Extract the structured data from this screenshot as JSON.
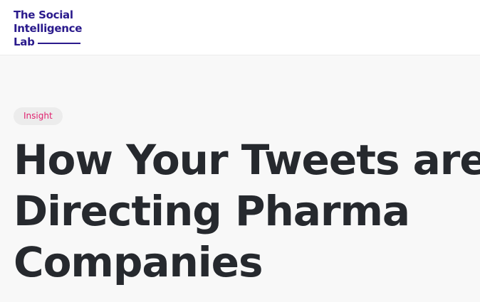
{
  "header": {
    "logo": {
      "line1": "The Social",
      "line2": "Intelligence",
      "line3": "Lab"
    }
  },
  "article": {
    "tag": "Insight",
    "title_lines": [
      "How Your Tweets are",
      "Directing Pharma",
      "Companies"
    ]
  },
  "colors": {
    "brand": "#2a1a8c",
    "tag_text": "#e0216e",
    "tag_bg": "#ececec",
    "title_text": "#26292e",
    "page_bg": "#f8f8f8"
  }
}
